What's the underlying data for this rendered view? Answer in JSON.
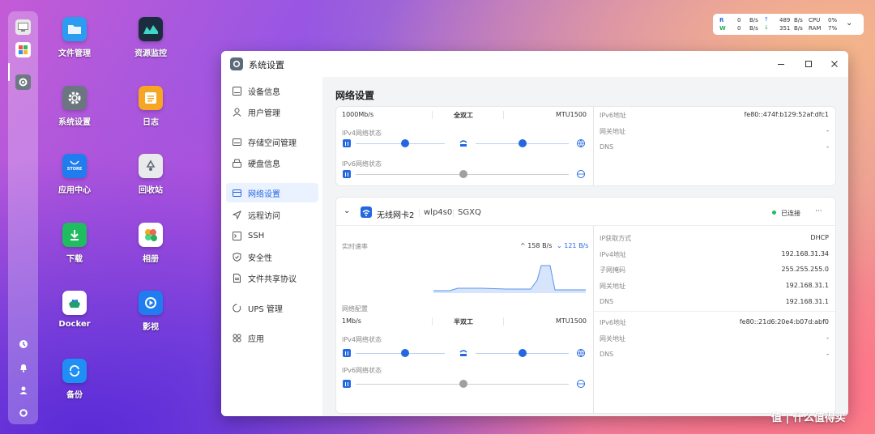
{
  "desktop": {
    "icons": [
      {
        "label": "文件管理"
      },
      {
        "label": "资源监控"
      },
      {
        "label": "系统设置"
      },
      {
        "label": "日志"
      },
      {
        "label": "应用中心",
        "sub": "STORE"
      },
      {
        "label": "回收站"
      },
      {
        "label": "下载"
      },
      {
        "label": "相册"
      },
      {
        "label": "Docker"
      },
      {
        "label": "影视"
      },
      {
        "label": "备份"
      }
    ]
  },
  "monitor": {
    "r_label": "R",
    "w_label": "W",
    "r_val": "0",
    "w_val": "0",
    "unit1": "B/s",
    "unit2": "B/s",
    "up_val": "489",
    "down_val": "351",
    "unit3": "B/s",
    "unit4": "B/s",
    "cpu_label": "CPU",
    "ram_label": "RAM",
    "cpu_val": "0%",
    "ram_val": "7%"
  },
  "window": {
    "title": "系统设置"
  },
  "sidebar": {
    "items": [
      {
        "label": "设备信息"
      },
      {
        "label": "用户管理"
      },
      {
        "label": "存储空间管理"
      },
      {
        "label": "硬盘信息"
      },
      {
        "label": "网络设置"
      },
      {
        "label": "远程访问"
      },
      {
        "label": "SSH"
      },
      {
        "label": "安全性"
      },
      {
        "label": "文件共享协议"
      },
      {
        "label": "UPS 管理"
      },
      {
        "label": "应用"
      }
    ]
  },
  "main": {
    "title": "网络设置",
    "card1": {
      "speed": "1000Mb/s",
      "duplex": "全双工",
      "mtu": "MTU1500",
      "ipv4_status": "IPv4网络状态",
      "ipv6_status": "IPv6网络状态",
      "right": [
        {
          "label": "IPv6地址",
          "value": "fe80::474f:b129:52af:dfc1"
        },
        {
          "label": "网关地址",
          "value": "-"
        },
        {
          "label": "DNS",
          "value": "-"
        }
      ]
    },
    "card2": {
      "name": "无线网卡2",
      "iface": "wlp4s0",
      "ssid": "SGXQ",
      "status": "已连接",
      "more": "···",
      "rate_label": "实时速率",
      "up": "158 B/s",
      "down": "121 B/s",
      "config_label": "网络配置",
      "speed": "1Mb/s",
      "duplex": "半双工",
      "mtu": "MTU1500",
      "ipv4_status": "IPv4网络状态",
      "ipv6_status": "IPv6网络状态",
      "right_v4": [
        {
          "label": "IP获取方式",
          "value": "DHCP"
        },
        {
          "label": "IPv4地址",
          "value": "192.168.31.34"
        },
        {
          "label": "子网掩码",
          "value": "255.255.255.0"
        },
        {
          "label": "网关地址",
          "value": "192.168.31.1"
        },
        {
          "label": "DNS",
          "value": "192.168.31.1"
        }
      ],
      "right_v6": [
        {
          "label": "IPv6地址",
          "value": "fe80::21d6:20e4:b07d:abf0"
        },
        {
          "label": "网关地址",
          "value": "-"
        },
        {
          "label": "DNS",
          "value": "-"
        }
      ]
    }
  },
  "watermark": {
    "text": "值 | 什么值得买"
  }
}
